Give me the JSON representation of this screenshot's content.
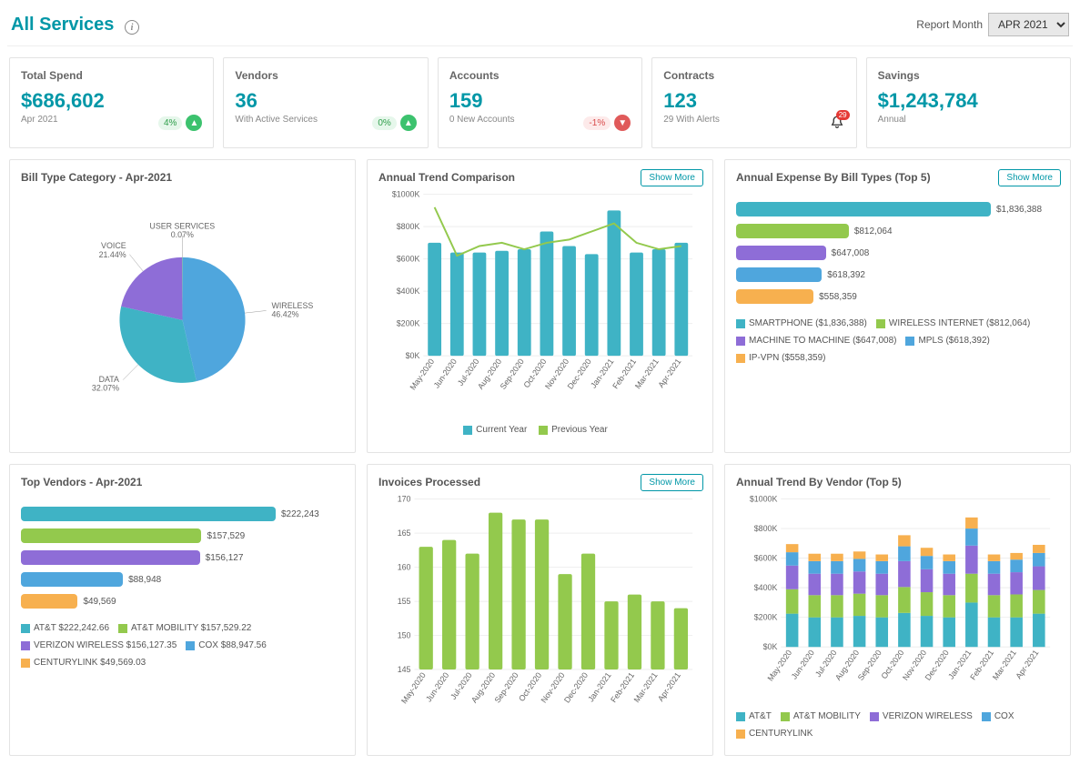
{
  "header": {
    "title": "All Services",
    "report_month_label": "Report Month",
    "report_month_value": "APR 2021"
  },
  "kpis": {
    "total_spend": {
      "label": "Total Spend",
      "value": "$686,602",
      "sub": "Apr 2021",
      "pct": "4%",
      "dir": "up"
    },
    "vendors": {
      "label": "Vendors",
      "value": "36",
      "sub": "With Active Services",
      "pct": "0%",
      "dir": "up"
    },
    "accounts": {
      "label": "Accounts",
      "value": "159",
      "sub": "0 New Accounts",
      "pct": "-1%",
      "dir": "down"
    },
    "contracts": {
      "label": "Contracts",
      "value": "123",
      "sub": "29 With Alerts",
      "alerts": "29"
    },
    "savings": {
      "label": "Savings",
      "value": "$1,243,784",
      "sub": "Annual"
    }
  },
  "panel_titles": {
    "bill_type": "Bill Type Category - Apr-2021",
    "annual_trend": "Annual Trend Comparison",
    "annual_expense": "Annual Expense By Bill Types (Top 5)",
    "top_vendors": "Top Vendors - Apr-2021",
    "invoices": "Invoices Processed",
    "trend_vendor": "Annual Trend By Vendor (Top 5)"
  },
  "show_more": "Show More",
  "colors": {
    "teal": "#3fb3c5",
    "green": "#93c94d",
    "purple": "#8e6dd7",
    "blue": "#4fa6dd",
    "orange": "#f7b04f"
  },
  "chart_data": [
    {
      "id": "bill_type_pie",
      "type": "pie",
      "title": "Bill Type Category - Apr-2021",
      "slices": [
        {
          "name": "WIRELESS",
          "pct": 46.42,
          "color": "#4fa6dd"
        },
        {
          "name": "DATA",
          "pct": 32.07,
          "color": "#3fb3c5"
        },
        {
          "name": "VOICE",
          "pct": 21.44,
          "color": "#8e6dd7"
        },
        {
          "name": "USER SERVICES",
          "pct": 0.07,
          "color": "#93c94d"
        }
      ]
    },
    {
      "id": "annual_trend",
      "type": "bar_line",
      "title": "Annual Trend Comparison",
      "categories": [
        "May-2020",
        "Jun-2020",
        "Jul-2020",
        "Aug-2020",
        "Sep-2020",
        "Oct-2020",
        "Nov-2020",
        "Dec-2020",
        "Jan-2021",
        "Feb-2021",
        "Mar-2021",
        "Apr-2021"
      ],
      "ylabel": "",
      "ylim": [
        0,
        1000000
      ],
      "ytick_fmt": "$K",
      "series": [
        {
          "name": "Current Year",
          "type": "bar",
          "color": "#3fb3c5",
          "values": [
            700000,
            640000,
            640000,
            650000,
            660000,
            770000,
            680000,
            630000,
            900000,
            640000,
            660000,
            700000
          ]
        },
        {
          "name": "Previous Year",
          "type": "line",
          "color": "#93c94d",
          "values": [
            920000,
            620000,
            680000,
            700000,
            660000,
            700000,
            720000,
            770000,
            820000,
            700000,
            660000,
            680000
          ]
        }
      ]
    },
    {
      "id": "annual_expense_bill",
      "type": "hbar",
      "title": "Annual Expense By Bill Types (Top 5)",
      "max": 1836388,
      "bars": [
        {
          "name": "SMARTPHONE",
          "value": 1836388,
          "label": "$1,836,388",
          "color": "#3fb3c5"
        },
        {
          "name": "WIRELESS INTERNET",
          "value": 812064,
          "label": "$812,064",
          "color": "#93c94d"
        },
        {
          "name": "MACHINE TO MACHINE",
          "value": 647008,
          "label": "$647,008",
          "color": "#8e6dd7"
        },
        {
          "name": "MPLS",
          "value": 618392,
          "label": "$618,392",
          "color": "#4fa6dd"
        },
        {
          "name": "IP-VPN",
          "value": 558359,
          "label": "$558,359",
          "color": "#f7b04f"
        }
      ],
      "legend": [
        "SMARTPHONE ($1,836,388)",
        "WIRELESS INTERNET ($812,064)",
        "MACHINE TO MACHINE ($647,008)",
        "MPLS ($618,392)",
        "IP-VPN ($558,359)"
      ]
    },
    {
      "id": "top_vendors",
      "type": "hbar",
      "title": "Top Vendors - Apr-2021",
      "max": 222243,
      "bars": [
        {
          "name": "AT&T",
          "value": 222243,
          "label": "$222,243",
          "color": "#3fb3c5"
        },
        {
          "name": "AT&T MOBILITY",
          "value": 157529,
          "label": "$157,529",
          "color": "#93c94d"
        },
        {
          "name": "VERIZON WIRELESS",
          "value": 156127,
          "label": "$156,127",
          "color": "#8e6dd7"
        },
        {
          "name": "COX",
          "value": 88948,
          "label": "$88,948",
          "color": "#4fa6dd"
        },
        {
          "name": "CENTURYLINK",
          "value": 49569,
          "label": "$49,569",
          "color": "#f7b04f"
        }
      ],
      "legend": [
        "AT&T $222,242.66",
        "AT&T MOBILITY $157,529.22",
        "VERIZON WIRELESS $156,127.35",
        "COX $88,947.56",
        "CENTURYLINK $49,569.03"
      ]
    },
    {
      "id": "invoices",
      "type": "bar",
      "title": "Invoices Processed",
      "categories": [
        "May-2020",
        "Jun-2020",
        "Jul-2020",
        "Aug-2020",
        "Sep-2020",
        "Oct-2020",
        "Nov-2020",
        "Dec-2020",
        "Jan-2021",
        "Feb-2021",
        "Mar-2021",
        "Apr-2021"
      ],
      "ylim": [
        145,
        170
      ],
      "color": "#93c94d",
      "values": [
        163,
        164,
        162,
        168,
        167,
        167,
        159,
        162,
        155,
        156,
        155,
        154
      ]
    },
    {
      "id": "trend_vendor",
      "type": "stacked_bar",
      "title": "Annual Trend By Vendor (Top 5)",
      "categories": [
        "May-2020",
        "Jun-2020",
        "Jul-2020",
        "Aug-2020",
        "Sep-2020",
        "Oct-2020",
        "Nov-2020",
        "Dec-2020",
        "Jan-2021",
        "Feb-2021",
        "Mar-2021",
        "Apr-2021"
      ],
      "ylim": [
        0,
        1000000
      ],
      "ytick_fmt": "$K",
      "series": [
        {
          "name": "AT&T",
          "color": "#3fb3c5",
          "values": [
            225000,
            200000,
            200000,
            210000,
            200000,
            230000,
            210000,
            200000,
            300000,
            200000,
            200000,
            225000
          ]
        },
        {
          "name": "AT&T MOBILITY",
          "color": "#93c94d",
          "values": [
            165000,
            150000,
            150000,
            150000,
            150000,
            175000,
            160000,
            150000,
            195000,
            150000,
            155000,
            160000
          ]
        },
        {
          "name": "VERIZON WIRELESS",
          "color": "#8e6dd7",
          "values": [
            160000,
            145000,
            145000,
            150000,
            145000,
            175000,
            155000,
            145000,
            190000,
            145000,
            150000,
            160000
          ]
        },
        {
          "name": "COX",
          "color": "#4fa6dd",
          "values": [
            90000,
            85000,
            85000,
            85000,
            85000,
            100000,
            90000,
            85000,
            115000,
            85000,
            85000,
            90000
          ]
        },
        {
          "name": "CENTURYLINK",
          "color": "#f7b04f",
          "values": [
            55000,
            50000,
            50000,
            50000,
            45000,
            75000,
            55000,
            45000,
            75000,
            45000,
            45000,
            55000
          ]
        }
      ]
    }
  ]
}
